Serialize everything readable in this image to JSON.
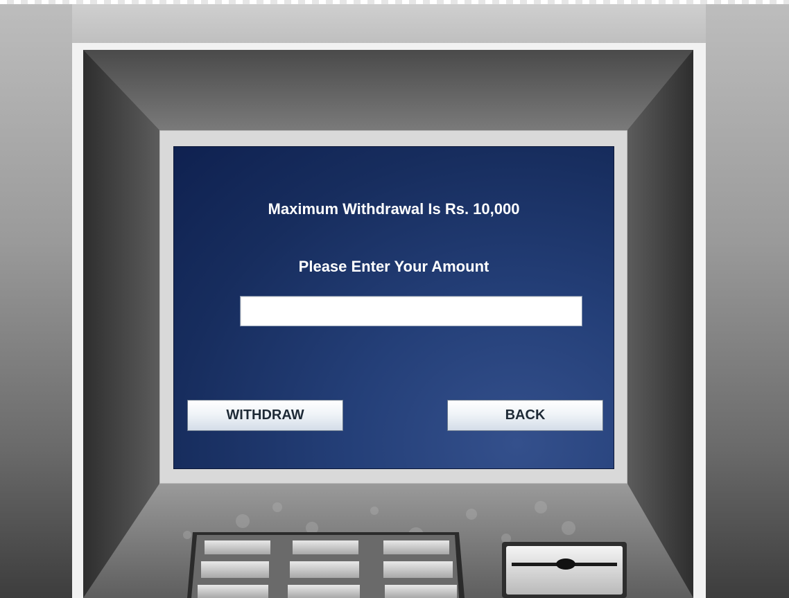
{
  "screen": {
    "max_withdrawal_text": "Maximum Withdrawal Is Rs. 10,000",
    "prompt_text": "Please Enter Your Amount",
    "amount_value": "",
    "withdraw_label": "WITHDRAW",
    "back_label": "BACK"
  },
  "colors": {
    "screen_bg": "#1b3366",
    "text": "#ffffff",
    "button_text": "#1e2a36",
    "machine_body": "#444444"
  }
}
